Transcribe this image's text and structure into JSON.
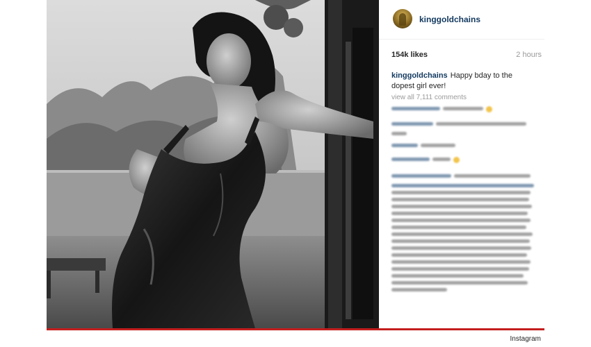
{
  "post": {
    "username": "kinggoldchains",
    "likes": "154k likes",
    "time": "2 hours",
    "caption_username": "kinggoldchains",
    "caption_text": "Happy bday to the dopest girl ever!",
    "view_all": "view all 7,111 comments"
  },
  "credit": "Instagram",
  "colors": {
    "username": "#12395f",
    "accent_bar": "#c41e1e"
  }
}
